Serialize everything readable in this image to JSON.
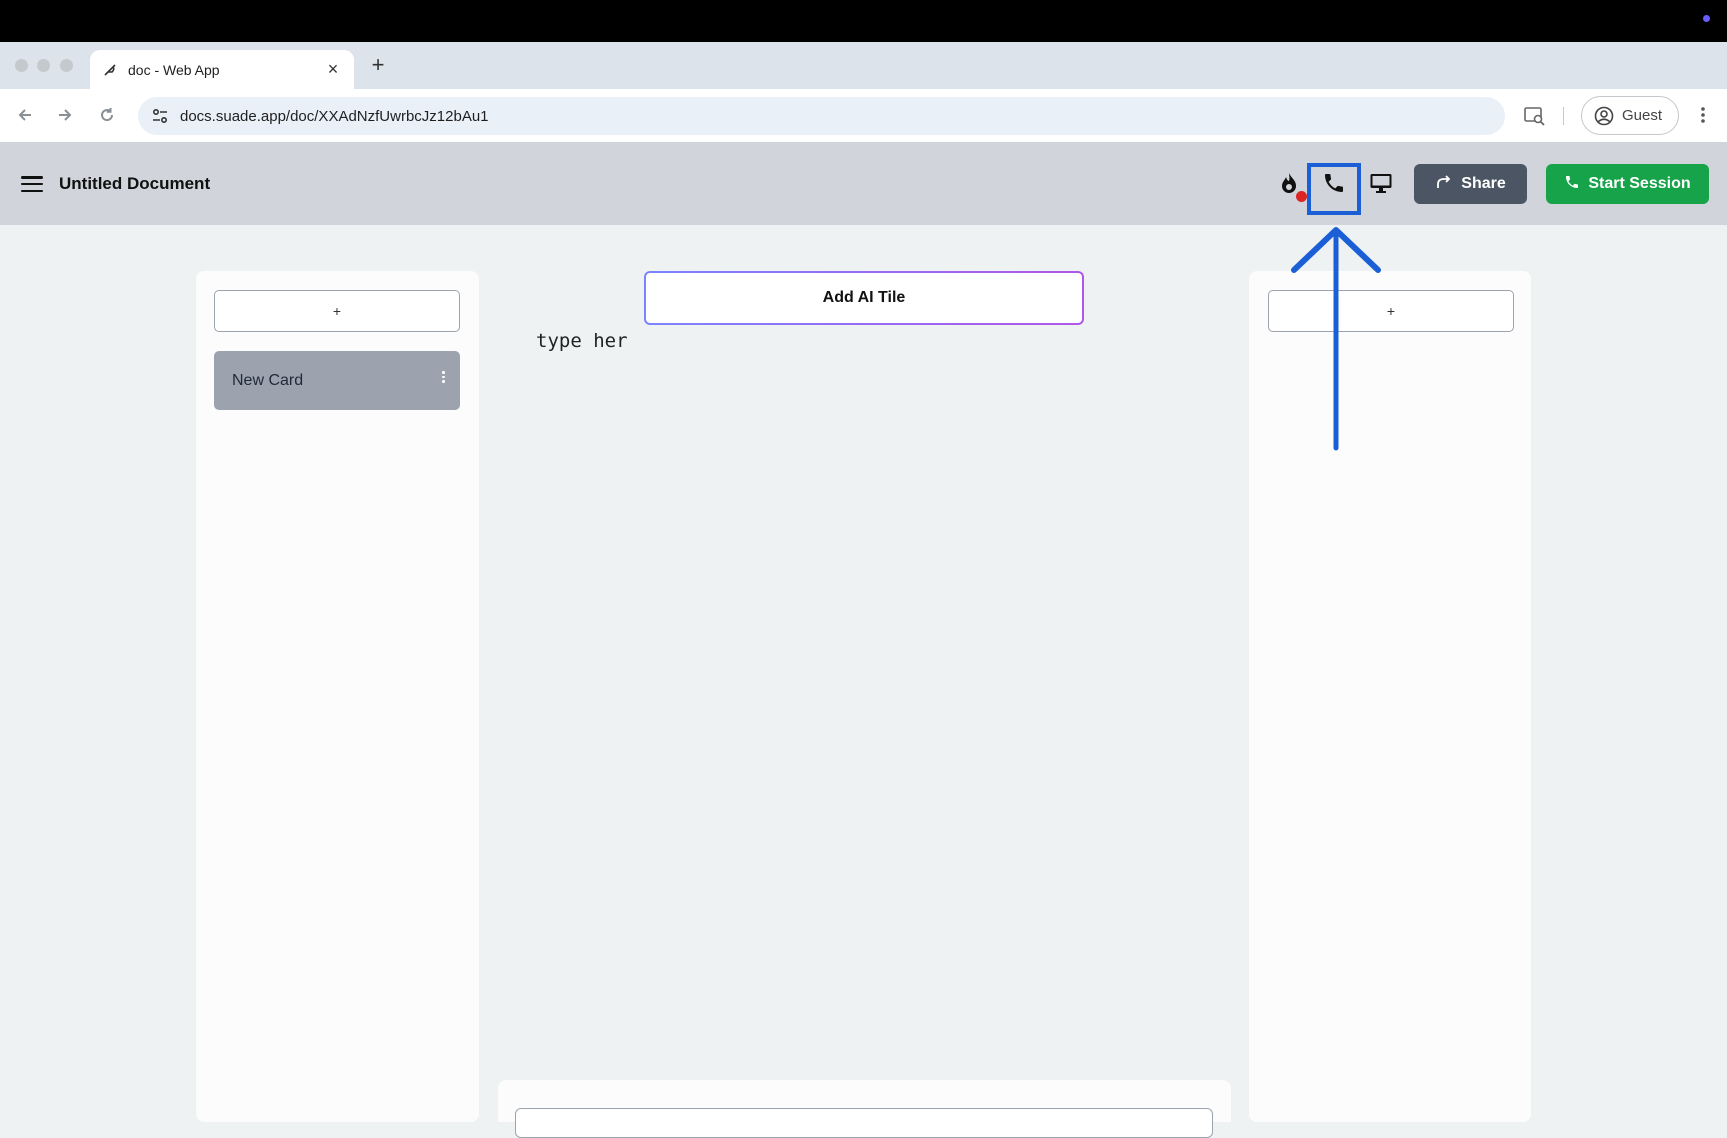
{
  "browser": {
    "tab_title": "doc - Web App",
    "new_tab_label": "+",
    "url": "docs.suade.app/doc/XXAdNzfUwrbcJz12bAu1",
    "profile_label": "Guest"
  },
  "app": {
    "doc_title": "Untitled Document",
    "share_label": "Share",
    "start_session_label": "Start Session"
  },
  "left_panel": {
    "add_label": "+",
    "cards": [
      {
        "label": "New Card"
      }
    ]
  },
  "editor": {
    "ai_tile_label": "Add AI Tile",
    "text": "type her"
  },
  "right_panel": {
    "add_label": "+"
  },
  "annotation": {
    "highlight_color": "#1a5fd6"
  },
  "colors": {
    "start_session": "#16a34a",
    "share": "#4b5563",
    "header": "#d1d5db",
    "badge": "#dc2626"
  }
}
